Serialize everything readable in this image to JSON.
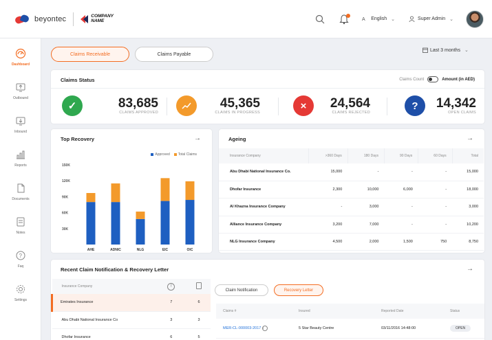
{
  "header": {
    "brand": "beyontec",
    "company_line1": "COMPANY",
    "company_line2": "NAME",
    "language": "English",
    "user": "Super Admin"
  },
  "sidebar": {
    "items": [
      {
        "label": "Dashboard",
        "icon": "dashboard-icon",
        "active": true
      },
      {
        "label": "Outbound",
        "icon": "outbound-icon"
      },
      {
        "label": "Inbound",
        "icon": "inbound-icon"
      },
      {
        "label": "Reports",
        "icon": "reports-icon"
      },
      {
        "label": "Documents",
        "icon": "documents-icon"
      },
      {
        "label": "Notes",
        "icon": "notes-icon"
      },
      {
        "label": "Faq",
        "icon": "faq-icon"
      },
      {
        "label": "Settings",
        "icon": "settings-icon"
      }
    ]
  },
  "tabs": {
    "receivable": "Claims Receivable",
    "payable": "Claims Payable"
  },
  "period": "Last 3 months",
  "claims_status": {
    "title": "Claims Status",
    "toggle_left": "Claims Count",
    "toggle_right": "Amount (in AED)",
    "stats": [
      {
        "value": "83,685",
        "caption": "CLAIMS APPROVED",
        "color": "#2fa84f",
        "icon": "check-icon"
      },
      {
        "value": "45,365",
        "caption": "CLAIMS IN PROGRESS",
        "color": "#f39a2b",
        "icon": "trend-icon"
      },
      {
        "value": "24,564",
        "caption": "CLAIMS REJECTED",
        "color": "#e53935",
        "icon": "x-icon"
      },
      {
        "value": "14,342",
        "caption": "OPEN CLAIMS",
        "color": "#1e4fa8",
        "icon": "question-icon"
      }
    ]
  },
  "top_recovery": {
    "title": "Top Recovery"
  },
  "chart_data": {
    "type": "bar",
    "stacked": true,
    "categories": [
      "AHE",
      "ADNIC",
      "NLG",
      "EIC",
      "OIC"
    ],
    "series": [
      {
        "name": "Approved",
        "values": [
          80,
          80,
          48,
          82,
          84
        ],
        "color": "#1e5fc1"
      },
      {
        "name": "Total Claims",
        "values": [
          17,
          35,
          14,
          43,
          35
        ],
        "color": "#f39a2b"
      }
    ],
    "y_ticks": [
      "30K",
      "60K",
      "90K",
      "120K",
      "150K"
    ],
    "ylim": [
      0,
      150
    ],
    "legend_position": "top-right",
    "grid": false
  },
  "ageing": {
    "title": "Ageing",
    "columns": [
      "Insurance Company",
      ">360 Days",
      "180 Days",
      "90 Days",
      "60 Days",
      "Total"
    ],
    "rows": [
      [
        "Abu Dhabi National Insurance Co.",
        "15,000",
        "-",
        "-",
        "-",
        "15,000"
      ],
      [
        "Dhofar Insurance",
        "2,300",
        "10,000",
        "6,000",
        "-",
        "18,000"
      ],
      [
        "Al Khazna Insurance Company",
        "-",
        "3,000",
        "-",
        "-",
        "3,000"
      ],
      [
        "Alliance Insurance Company",
        "3,200",
        "7,000",
        "-",
        "-",
        "10,200"
      ],
      [
        "NLG Insurance Company",
        "4,500",
        "2,000",
        "1,500",
        "750",
        "8,750"
      ]
    ]
  },
  "recent": {
    "title": "Recent Claim Notification & Recovery Letter",
    "left_header": "Insurance Company",
    "left_rows": [
      [
        "Emirates Insurance",
        "7",
        "6"
      ],
      [
        "Abu Dhabi National Insurance Co",
        "3",
        "3"
      ],
      [
        "Dhofar Insurance",
        "6",
        "5"
      ]
    ],
    "subtab_notification": "Claim Notification",
    "subtab_recovery": "Recovery Letter",
    "right_columns": [
      "Claims #",
      "Insured",
      "Reported Date",
      "Status"
    ],
    "right_rows": [
      [
        "MER-CL-000003-2017",
        "5 Star Beauty Centre",
        "03/11/2016 14:48:00",
        "OPEN"
      ]
    ]
  },
  "colors": {
    "accent": "#f36c21",
    "blue": "#1e5fc1",
    "orange": "#f39a2b"
  }
}
